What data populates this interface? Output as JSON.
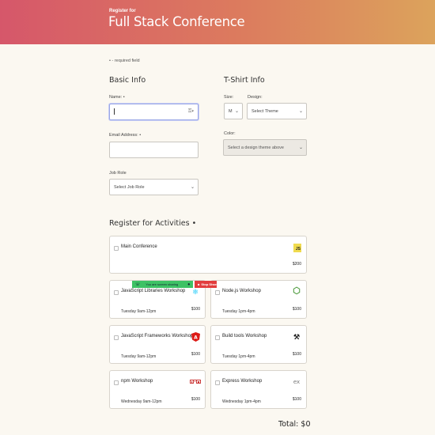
{
  "header": {
    "subtitle": "Register for",
    "title": "Full Stack Conference"
  },
  "required_note": "• - required field",
  "basic_info": {
    "heading": "Basic Info",
    "name_label": "Name: •",
    "email_label": "Email Address: •",
    "job_role_label": "Job Role",
    "job_role_value": "Select Job Role"
  },
  "tshirt_info": {
    "heading": "T-Shirt Info",
    "size_label": "Size:",
    "size_value": "M",
    "design_label": "Design:",
    "design_value": "Select Theme",
    "color_label": "Color:",
    "color_value": "Select a design theme above"
  },
  "activities": {
    "heading": "Register for Activities •",
    "items": [
      {
        "name": "Main Conference",
        "time": "",
        "price": "$200",
        "logo": "js-icon"
      },
      {
        "name": "JavaScript Libraries Workshop",
        "time": "Tuesday 9am-12pm",
        "price": "$100",
        "logo": "react-icon"
      },
      {
        "name": "Node.js Workshop",
        "time": "Tuesday 1pm-4pm",
        "price": "$100",
        "logo": "nodejs-icon"
      },
      {
        "name": "JavaScript Frameworks Workshop",
        "time": "Tuesday 9am-12pm",
        "price": "$100",
        "logo": "angular-icon"
      },
      {
        "name": "Build tools Workshop",
        "time": "Tuesday 1pm-4pm",
        "price": "$100",
        "logo": "tools-icon"
      },
      {
        "name": "npm Workshop",
        "time": "Wednesday 9am-12pm",
        "price": "$100",
        "logo": "npm-icon"
      },
      {
        "name": "Express Workshop",
        "time": "Wednesday 1pm-4pm",
        "price": "$100",
        "logo": "express-icon"
      }
    ]
  },
  "screen_share": {
    "status": "You are screen sharing",
    "stop_label": "Stop Share"
  },
  "total": "Total: $0",
  "colors": {
    "header_start": "#d6576a",
    "header_end": "#dca35c",
    "share_green": "#3ec265",
    "share_red": "#e23d3d"
  }
}
